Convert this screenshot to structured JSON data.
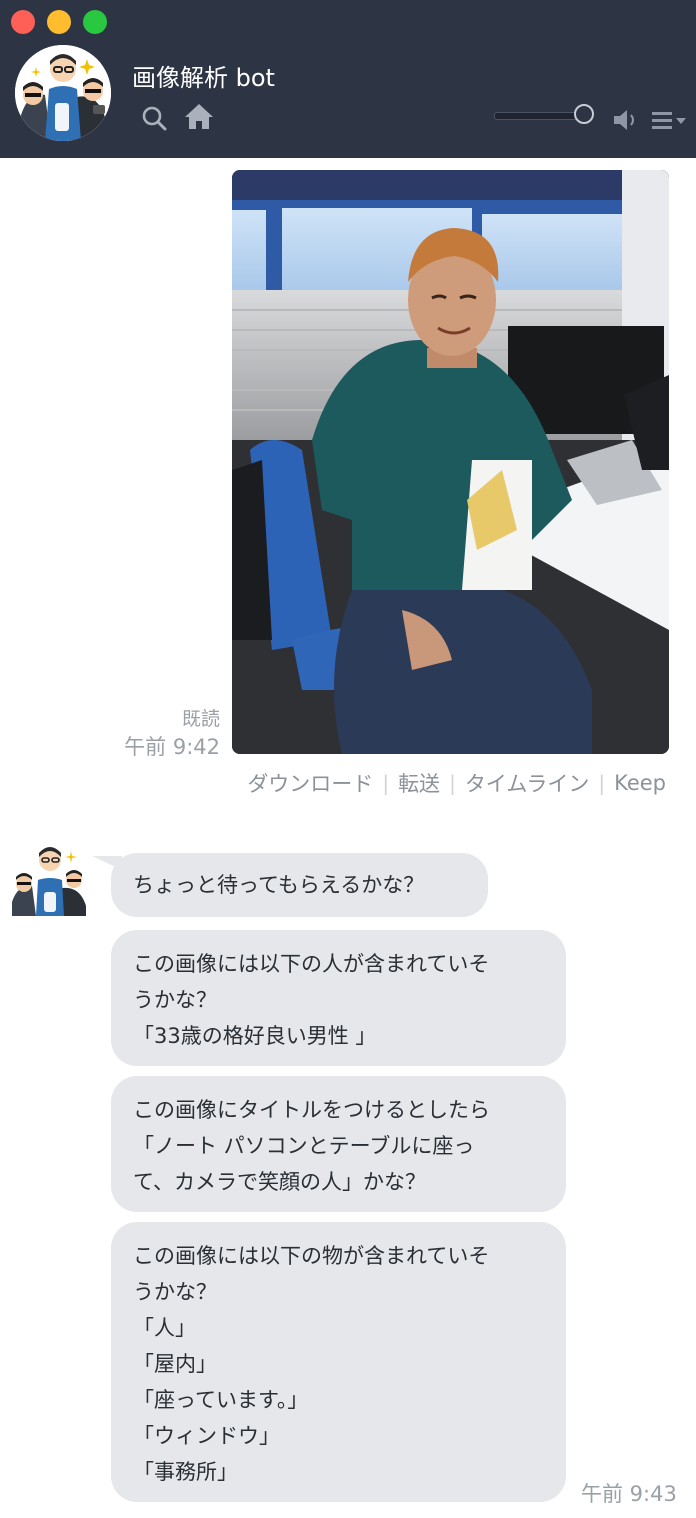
{
  "window": {
    "title": "画像解析 bot",
    "controls": [
      "close",
      "minimize",
      "zoom"
    ],
    "volume_level": 0.9
  },
  "header": {
    "icons": [
      "search-icon",
      "home-icon",
      "speaker-icon",
      "menu-icon"
    ]
  },
  "sent_message": {
    "read_label": "既読",
    "time": "午前 9:42"
  },
  "image_actions": {
    "download": "ダウンロード",
    "forward": "転送",
    "timeline": "タイムライン",
    "keep": "Keep"
  },
  "received": {
    "messages": [
      {
        "lines": [
          "ちょっと待ってもらえるかな？"
        ]
      },
      {
        "lines": [
          "この画像には以下の人が含まれていそ",
          "うかな？",
          "「33歳の格好良い男性 」"
        ]
      },
      {
        "lines": [
          "この画像にタイトルをつけるとしたら",
          "「ノート パソコンとテーブルに座っ",
          "て、カメラで笑顔の人」かな？"
        ]
      },
      {
        "lines": [
          "この画像には以下の物が含まれていそ",
          "うかな？",
          "「人」",
          "「屋内」",
          "「座っています。」",
          "「ウィンドウ」",
          "「事務所」"
        ]
      }
    ],
    "time": "午前 9:43"
  },
  "colors": {
    "titlebar": "#2d3443",
    "bubble": "#e5e7ea",
    "meta_text": "#9aa0a6"
  }
}
